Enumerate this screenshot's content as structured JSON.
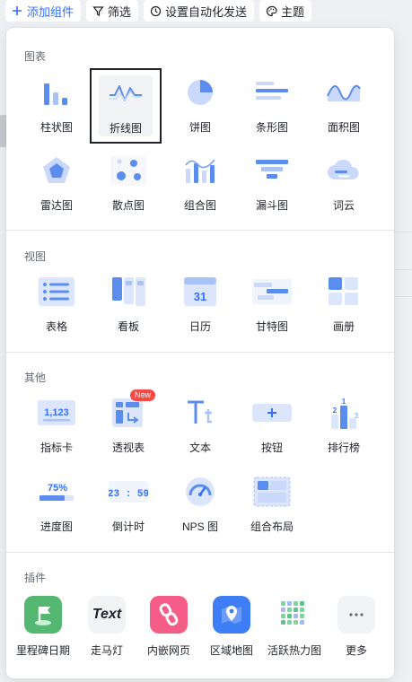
{
  "toolbar": {
    "add_label": "添加组件",
    "filter_label": "筛选",
    "automation_label": "设置自动化发送",
    "theme_label": "主题"
  },
  "sections": {
    "charts": {
      "title": "图表",
      "items": [
        "柱状图",
        "折线图",
        "饼图",
        "条形图",
        "面积图",
        "雷达图",
        "散点图",
        "组合图",
        "漏斗图",
        "词云"
      ]
    },
    "views": {
      "title": "视图",
      "items": [
        "表格",
        "看板",
        "日历",
        "甘特图",
        "画册"
      ],
      "calendar_day": "31"
    },
    "others": {
      "title": "其他",
      "items": [
        "指标卡",
        "透视表",
        "文本",
        "按钮",
        "排行榜",
        "进度图",
        "倒计时",
        "NPS 图",
        "组合布局"
      ],
      "new_badge": "New",
      "metric_value": "1,123",
      "progress_value": "75%",
      "countdown_text": "23 : 59",
      "rank_numbers": [
        "2",
        "1",
        "3"
      ]
    },
    "plugins": {
      "title": "插件",
      "items": [
        "里程碑日期",
        "走马灯",
        "内嵌网页",
        "区域地图",
        "活跃热力图",
        "更多"
      ],
      "carousel_glyph": "Text"
    }
  },
  "colors": {
    "accent": "#3370ff",
    "icon_blue": "#5b8def",
    "icon_light": "#c9d8fb",
    "badge_red": "#f54a45"
  }
}
